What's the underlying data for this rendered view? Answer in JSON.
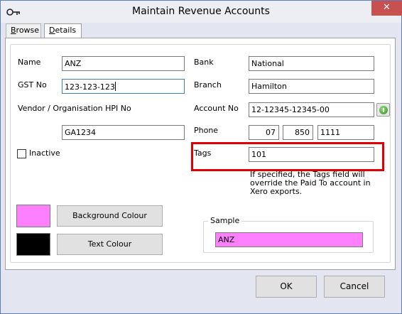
{
  "window": {
    "title": "Maintain Revenue Accounts",
    "close_symbol": "✕",
    "icon": "key-icon"
  },
  "tabs": [
    {
      "label": "Browse",
      "underline": "B",
      "rest": "rowse",
      "active": false
    },
    {
      "label": "Details",
      "underline": "D",
      "rest": "etails",
      "active": true
    }
  ],
  "form": {
    "name_label": "Name",
    "name_value": "ANZ",
    "gst_label": "GST No",
    "gst_value": "123-123-123",
    "vendor_label": "Vendor / Organisation HPI No",
    "vendor_value": "GA1234",
    "inactive_label": "Inactive",
    "inactive_checked": false,
    "bank_label": "Bank",
    "bank_value": "National",
    "branch_label": "Branch",
    "branch_value": "Hamilton",
    "account_label": "Account No",
    "account_value": "12-12345-12345-00",
    "phone_label": "Phone",
    "phone_area": "07",
    "phone_prefix": "850",
    "phone_number": "1111",
    "tags_label": "Tags",
    "tags_value": "101",
    "tags_note": "If specified, the Tags field will override the Paid To account in Xero exports."
  },
  "colours": {
    "background_button": "Background Colour",
    "text_button": "Text Colour",
    "background_swatch": "#ff80ff",
    "text_swatch": "#000000",
    "highlight": "#e00000"
  },
  "sample": {
    "label": "Sample",
    "value": "ANZ"
  },
  "actions": {
    "ok_label": "OK",
    "cancel_label": "Cancel"
  }
}
